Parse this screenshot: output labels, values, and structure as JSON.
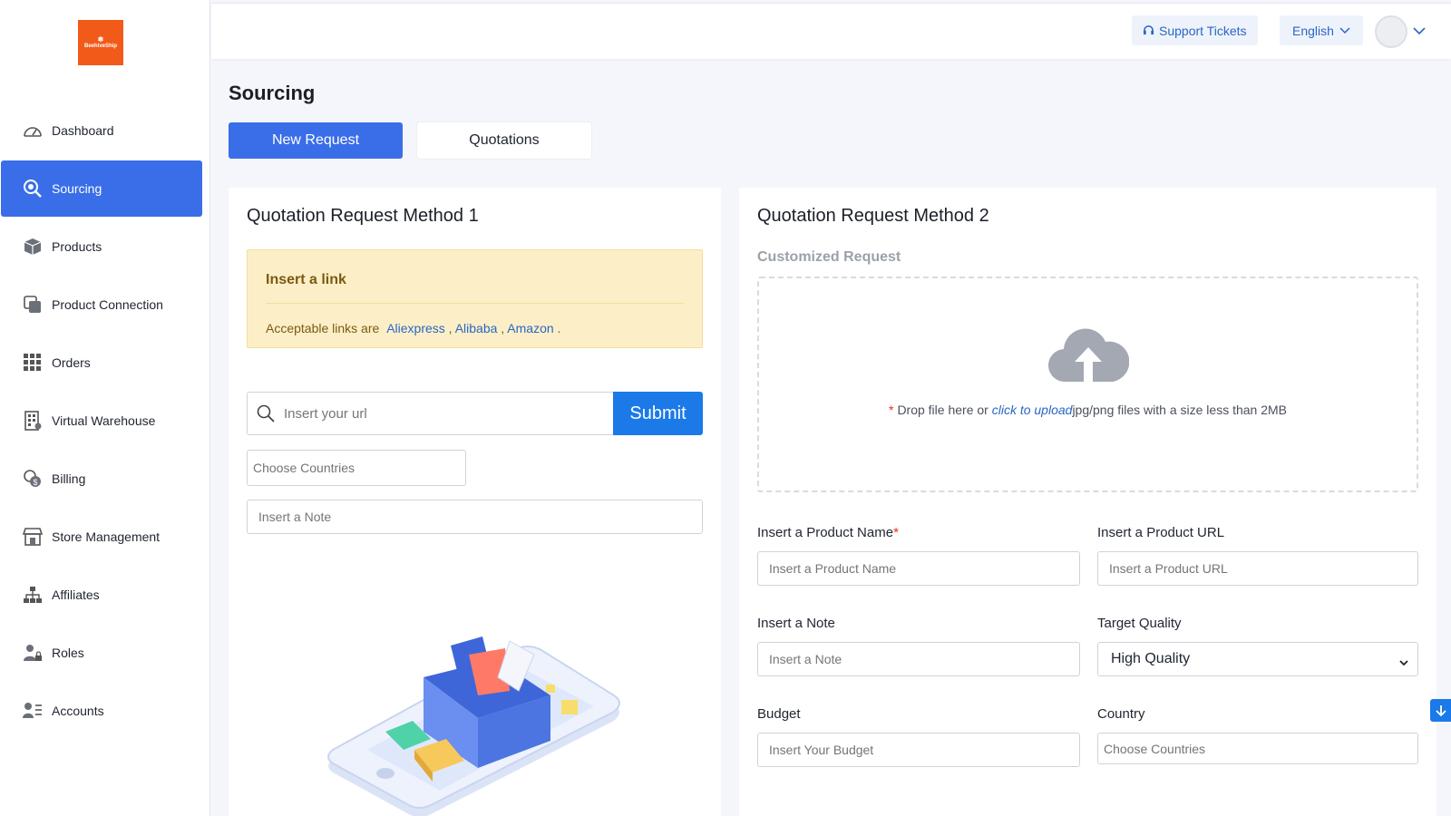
{
  "brand": {
    "logo_text": "BeehiveShip",
    "logo_color": "#f25a1a"
  },
  "sidebar": {
    "items": [
      {
        "label": "Dashboard",
        "icon": "dashboard-icon",
        "active": false
      },
      {
        "label": "Sourcing",
        "icon": "search-icon",
        "active": true
      },
      {
        "label": "Products",
        "icon": "box-icon",
        "active": false
      },
      {
        "label": "Product Connection",
        "icon": "copy-icon",
        "active": false
      },
      {
        "label": "Orders",
        "icon": "grid-icon",
        "active": false
      },
      {
        "label": "Virtual Warehouse",
        "icon": "building-icon",
        "active": false
      },
      {
        "label": "Billing",
        "icon": "coins-icon",
        "active": false
      },
      {
        "label": "Store Management",
        "icon": "store-icon",
        "active": false
      },
      {
        "label": "Affiliates",
        "icon": "hierarchy-icon",
        "active": false
      },
      {
        "label": "Roles",
        "icon": "user-lock-icon",
        "active": false
      },
      {
        "label": "Accounts",
        "icon": "user-list-icon",
        "active": false
      }
    ]
  },
  "header": {
    "support_label": "Support Tickets",
    "language_label": "English"
  },
  "main": {
    "title": "Sourcing",
    "tabs": [
      {
        "label": "New Request",
        "active": true
      },
      {
        "label": "Quotations",
        "active": false
      }
    ],
    "method1": {
      "title": "Quotation Request Method 1",
      "alert_title": "Insert a link",
      "alert_text": "Acceptable links are",
      "links": [
        "Aliexpress",
        "Alibaba",
        "Amazon"
      ],
      "url_placeholder": "Insert your url",
      "submit_label": "Submit",
      "countries_placeholder": "Choose Countries",
      "note_placeholder": "Insert a Note"
    },
    "method2": {
      "title": "Quotation Request Method 2",
      "subtitle": "Customized Request",
      "drop_text_before": "Drop file here or",
      "drop_link": "click to upload",
      "drop_text_after": "jpg/png files with a size less than 2MB",
      "product_name_label": "Insert a Product Name",
      "product_name_placeholder": "Insert a Product Name",
      "product_url_label": "Insert a Product URL",
      "product_url_placeholder": "Insert a Product URL",
      "note_label": "Insert a Note",
      "note_placeholder": "Insert a Note",
      "quality_label": "Target Quality",
      "quality_value": "High Quality",
      "budget_label": "Budget",
      "budget_placeholder": "Insert Your Budget",
      "country_label": "Country",
      "country_placeholder": "Choose Countries"
    }
  },
  "colors": {
    "accent": "#3a6ee8",
    "submit": "#1b7ae8",
    "alert_bg": "#fcefc7",
    "required": "#e0301e"
  }
}
